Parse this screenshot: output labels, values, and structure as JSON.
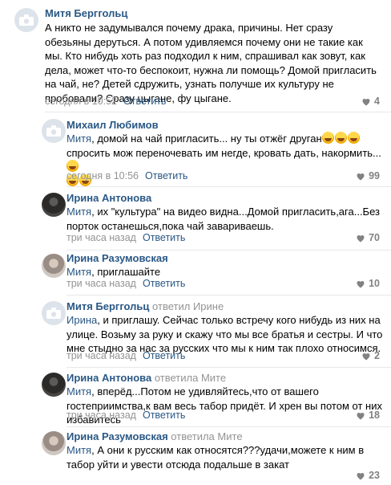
{
  "comments": [
    {
      "author": "Митя Берггольц",
      "reply_to": "",
      "text": "А никто не задумывался почему драка, причины. Нет сразу обезьяны деруться. А потом удивляемся почему они не такие как мы. Кто нибудь хоть раз подходил к ним, спрашивал как зовут, как дела, может что-то беспокоит, нужна ли помощь? Домой пригласить на чай, не? Детей сдружить, узнать получше их культуру не пробовали? Сразу цыгане, фу цыгане.",
      "time": "сегодня в 10:52",
      "reply_label": "Ответить",
      "likes": "4",
      "avatar": "camera-placeholder"
    },
    {
      "author": "Михаил Любимов",
      "reply_to": "",
      "mention": "Митя",
      "text_1": ", домой на чай пригласить... ну ты отжёг друган",
      "text_2": "спросить мож переночевать им негде, кровать дать, накормить...",
      "time": "сегодня в 10:56",
      "reply_label": "Ответить",
      "likes": "99",
      "avatar": "camera-placeholder"
    },
    {
      "author": "Ирина Антонова",
      "reply_to": "",
      "mention": "Митя",
      "text": ", их \"культура\" на видео видна...Домой пригласить,ага...Без порток останешься,пока чай завариваешь.",
      "time": "три часа назад",
      "reply_label": "Ответить",
      "likes": "70",
      "avatar": "photo-dark"
    },
    {
      "author": "Ирина Разумовская",
      "reply_to": "",
      "mention": "Митя",
      "text": ", приглашайте",
      "time": "три часа назад",
      "reply_label": "Ответить",
      "likes": "10",
      "avatar": "photo-light"
    },
    {
      "author": "Митя Берггольц",
      "reply_to": "ответил",
      "reply_to_name": "Ирине",
      "mention": "Ирина",
      "text": ", и приглашу. Сейчас только встречу кого нибудь из них на улице. Возьму за руку и скажу что мы все братья и сестры. И что мне стыдно за нас за русских что мы к ним так плохо относимся.",
      "time": "три часа назад",
      "reply_label": "Ответить",
      "likes": "2",
      "avatar": "camera-placeholder"
    },
    {
      "author": "Ирина Антонова",
      "reply_to": "ответила",
      "reply_to_name": "Мите",
      "mention": "Митя",
      "text": ", вперёд...Потом не удивляйтесь,что от вашего гостеприимства,к вам весь табор придёт. И хрен вы потом от них избавитесь",
      "time": "три часа назад",
      "reply_label": "Ответить",
      "likes": "18",
      "avatar": "photo-dark"
    },
    {
      "author": "Ирина Разумовская",
      "reply_to": "ответила",
      "reply_to_name": "Мите",
      "mention": "Митя",
      "text": ", А они к русским как относятся???удачи,можете к ним в табор уйти и увести отсюда подальше в закат",
      "time": "три часа назад",
      "reply_label": "Ответить",
      "likes": "23",
      "avatar": "photo-light"
    }
  ],
  "colors": {
    "link": "#2a5885",
    "meta": "#939393",
    "like": "#828282",
    "divider": "#e7e8ec"
  },
  "icons": {
    "avatar_placeholder": "camera-icon",
    "like": "heart-icon",
    "emoji": "rolling-laughing-emoji"
  }
}
